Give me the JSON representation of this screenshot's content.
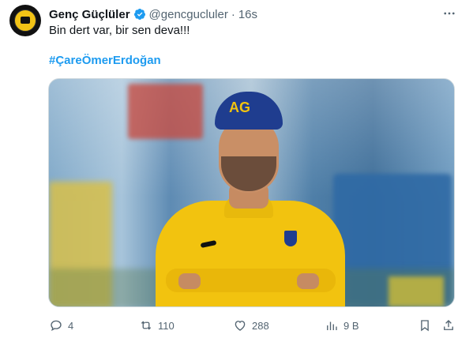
{
  "user": {
    "name": "Genç Güçlüler",
    "handle": "@gencgucluler",
    "time": "16s"
  },
  "post": {
    "text": "Bin dert var, bir sen deva!!!",
    "hashtag": "#ÇareÖmerErdoğan"
  },
  "actions": {
    "replies": "4",
    "reposts": "110",
    "likes": "288",
    "views": "9 B"
  },
  "media": {
    "cap_text": "AG"
  },
  "colors": {
    "link": "#1d9bf0",
    "verified": "#1d9bf0",
    "muted": "#536471"
  }
}
